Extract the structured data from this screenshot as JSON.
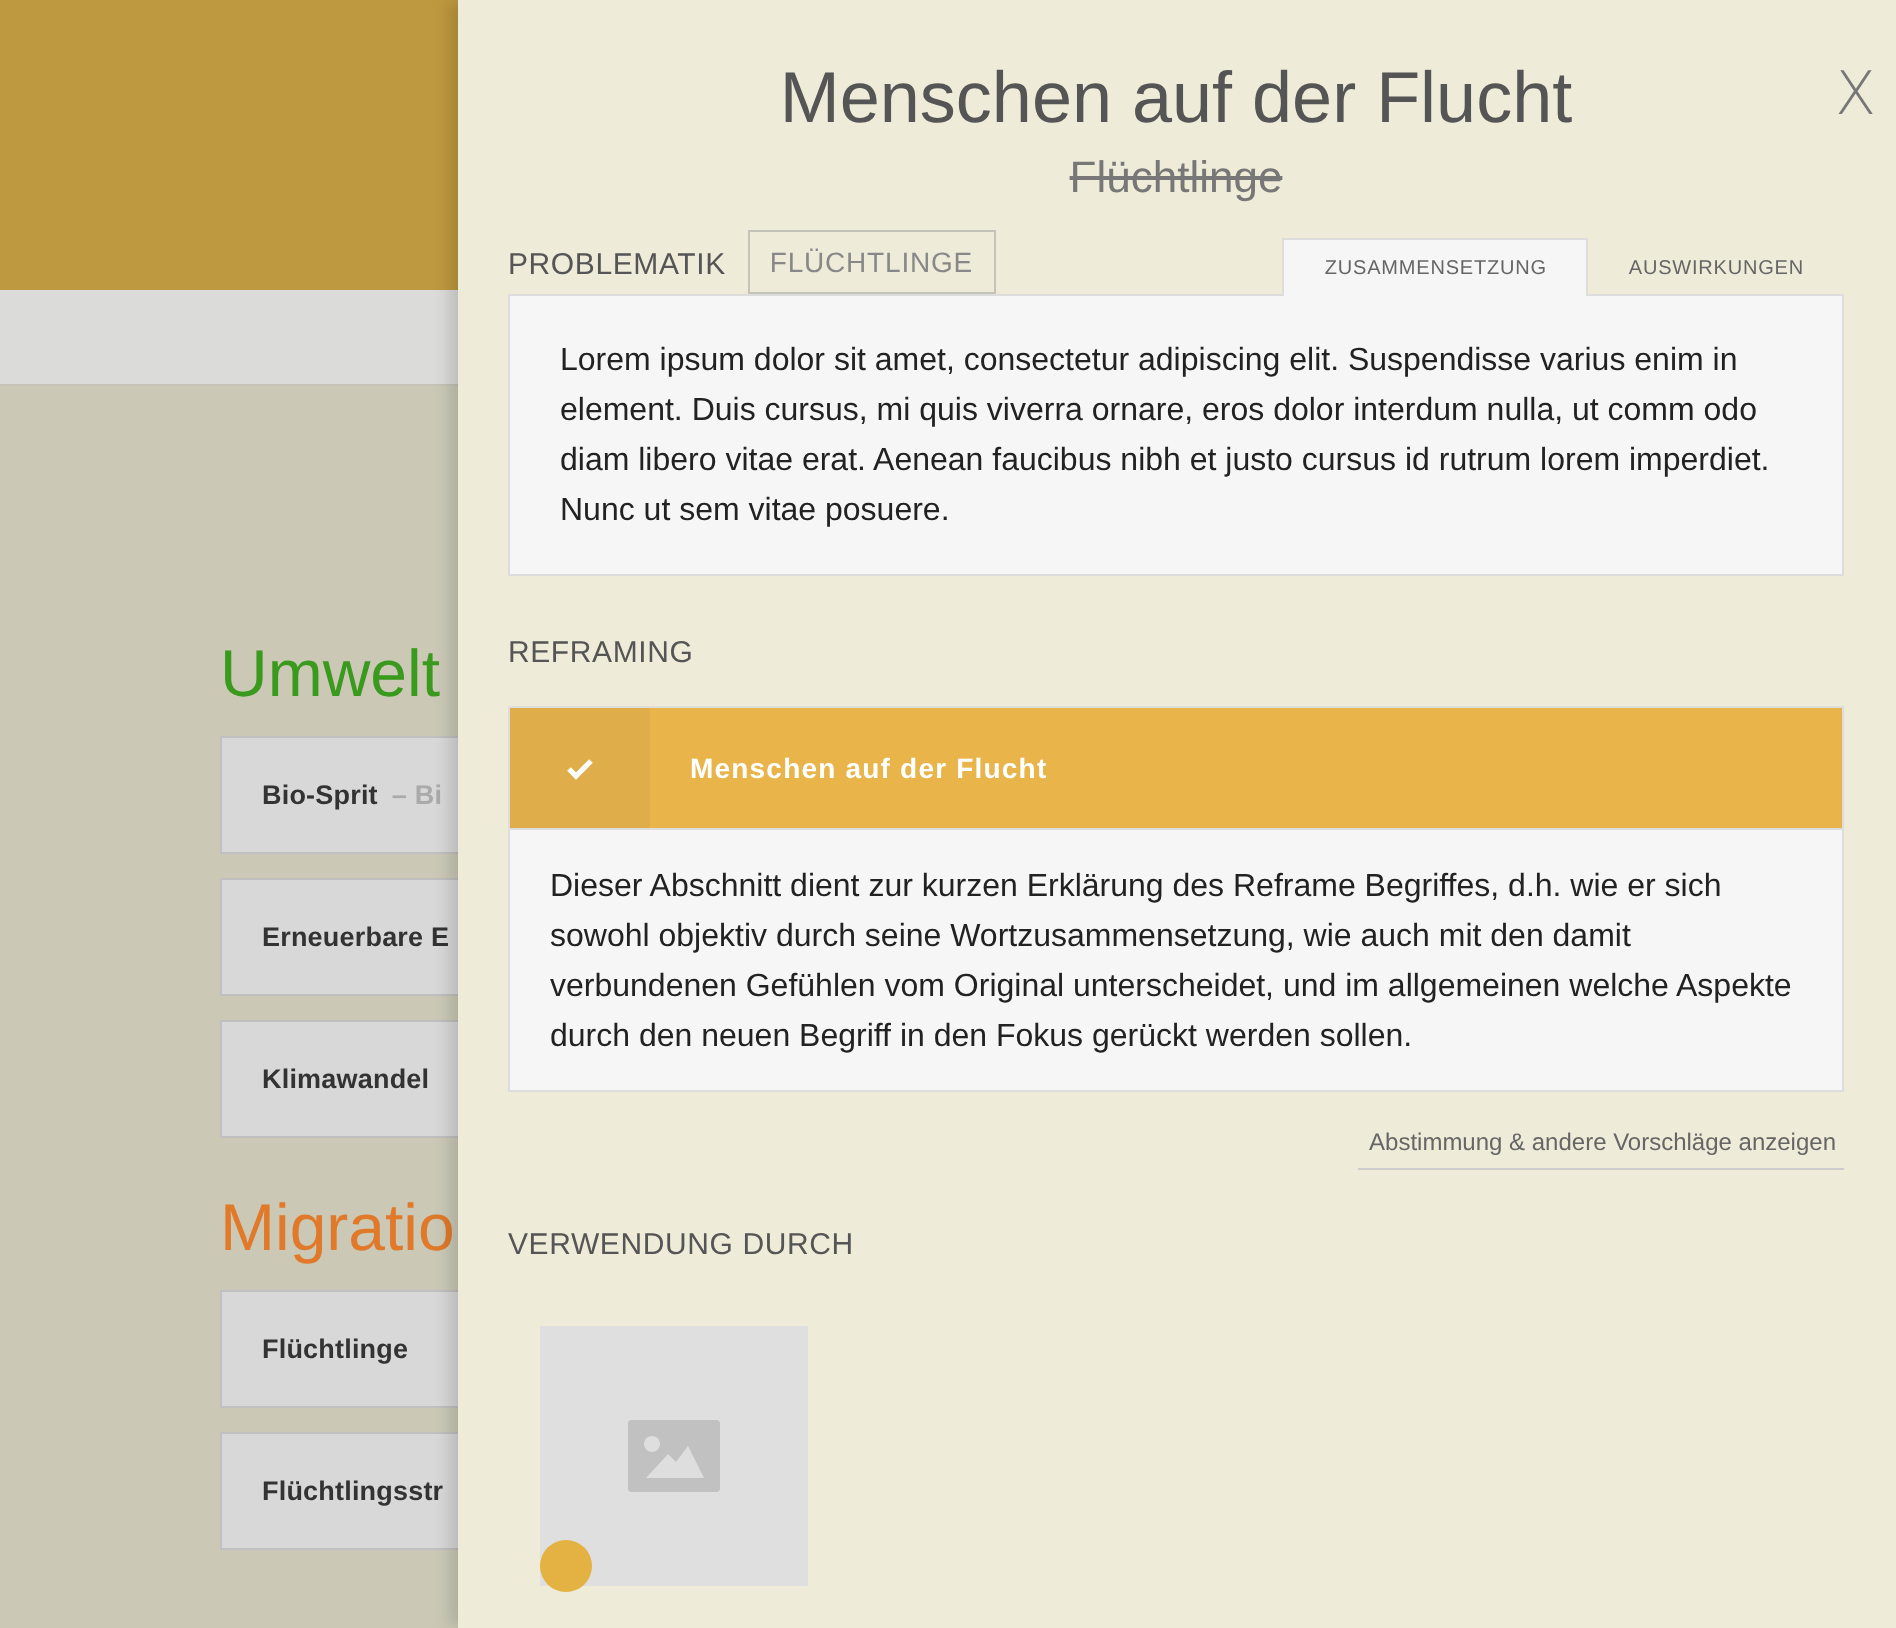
{
  "background": {
    "categories": [
      {
        "title": "Umwelt",
        "color": "#3a9a1e",
        "items": [
          {
            "label": "Bio-Sprit",
            "sublabel": "– Bi"
          },
          {
            "label": "Erneuerbare E"
          },
          {
            "label": "Klimawandel"
          }
        ]
      },
      {
        "title": "Migratio",
        "color": "#e07a2a",
        "items": [
          {
            "label": "Flüchtlinge"
          },
          {
            "label": "Flüchtlingsstr"
          }
        ]
      }
    ]
  },
  "panel": {
    "title": "Menschen auf der Flucht",
    "replaced_term": "Flüchtlinge",
    "close": "X",
    "problematik": {
      "label": "PROBLEMATIK",
      "tag": "FLÜCHTLINGE",
      "tabs": [
        {
          "label": "ZUSAMMENSETZUNG",
          "selected": true
        },
        {
          "label": "AUSWIRKUNGEN",
          "selected": false
        }
      ],
      "text": "Lorem ipsum dolor sit amet, consectetur adipiscing elit. Suspendisse varius enim in element. Duis cursus, mi quis viverra ornare, eros dolor interdum nulla, ut comm odo diam libero vitae erat. Aenean faucibus nibh et justo cursus id rutrum lorem imperdiet. Nunc ut sem vitae posuere."
    },
    "reframing": {
      "label": "REFRAMING",
      "option": {
        "label": "Menschen auf der Flucht",
        "checked": true
      },
      "text": "Dieser Abschnitt dient zur kurzen Erklärung des Reframe Begriffes, d.h. wie er sich sowohl objektiv durch seine Wortzusammensetzung, wie auch mit den damit verbundenen Gefühlen vom Original unterscheidet, und im allgemeinen welche Aspekte durch den neuen Begriff in den Fokus gerückt werden sollen.",
      "link": "Abstimmung & andere Vorschläge anzeigen"
    },
    "usage": {
      "label": "VERWENDUNG DURCH",
      "items": [
        {
          "kind": "placeholder"
        }
      ]
    }
  }
}
